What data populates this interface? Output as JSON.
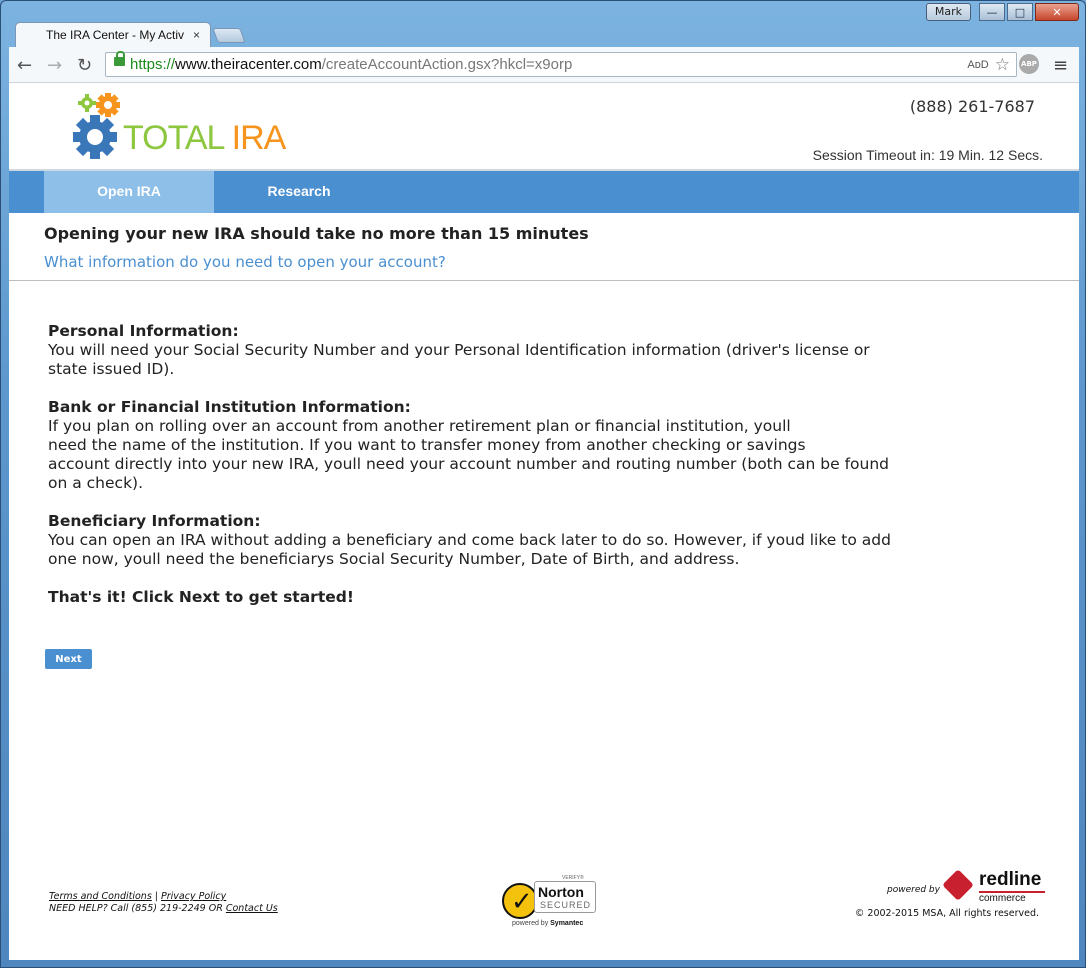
{
  "window": {
    "user_label": "Mark",
    "minimize_label": "—",
    "maximize_label": "□",
    "close_label": "✕"
  },
  "browser": {
    "tab_title": "The IRA Center - My Activ",
    "tab_close": "×",
    "url_scheme": "https://",
    "url_host": "www.theiracenter.com",
    "url_path": "/createAccountAction.gsx?hkcl=x9orp",
    "reader_label": "AᴅD",
    "abp_label": "ABP",
    "back_icon": "←",
    "forward_icon": "→",
    "reload_icon": "↻",
    "star_icon": "☆",
    "menu_icon": "≡"
  },
  "header": {
    "logo_part1": "TOTAL",
    "logo_part2": " IRA",
    "phone": "(888) 261-7687",
    "session_timeout": "Session Timeout in: 19 Min. 12 Secs."
  },
  "nav": {
    "items": [
      {
        "label": "Open IRA"
      },
      {
        "label": "Research"
      }
    ]
  },
  "intro": {
    "heading": "Opening your new IRA should take no more than 15 minutes",
    "link": "What information do you need to open your account?"
  },
  "sections": [
    {
      "title": "Personal Information:",
      "body": "You will need your Social Security Number and your Personal Identification information (driver's license or\nstate issued ID)."
    },
    {
      "title": "Bank or Financial Institution Information:",
      "body": "If you plan on rolling over an account from another retirement plan or financial institution, youll\nneed the name of the institution. If you want to transfer money from another checking or savings\naccount directly into your new IRA, youll need your account number and routing number (both can be found\non a check)."
    },
    {
      "title": "Beneficiary Information:",
      "body": "You can open an IRA without adding a beneficiary and come back later to do so. However, if youd like to add\none now, youll need the beneficiarys Social Security Number, Date of Birth, and address."
    }
  ],
  "final_text": "That's it! Click Next to get started!",
  "next_button": "Next",
  "footer": {
    "terms": "Terms and Conditions",
    "separator": " | ",
    "privacy": "Privacy Policy",
    "help_text": "NEED HELP? Call (855) 219-2249 OR ",
    "contact": "Contact Us",
    "norton_verify": "VERIFY®",
    "norton_name": "Norton",
    "norton_secured": "SECURED",
    "norton_powered": "powered by ",
    "norton_symantec": "Symantec",
    "powered_by": "powered by",
    "redline_name": "redline",
    "redline_sub": "commerce",
    "copyright": "© 2002-2015 MSA, All rights reserved."
  },
  "colors": {
    "nav_bg": "#4a8fd0",
    "nav_active": "#8ebfe9",
    "link": "#4a8fd0",
    "logo_green": "#8dc63f",
    "logo_orange": "#f7941d",
    "logo_blue": "#3a77b8"
  }
}
